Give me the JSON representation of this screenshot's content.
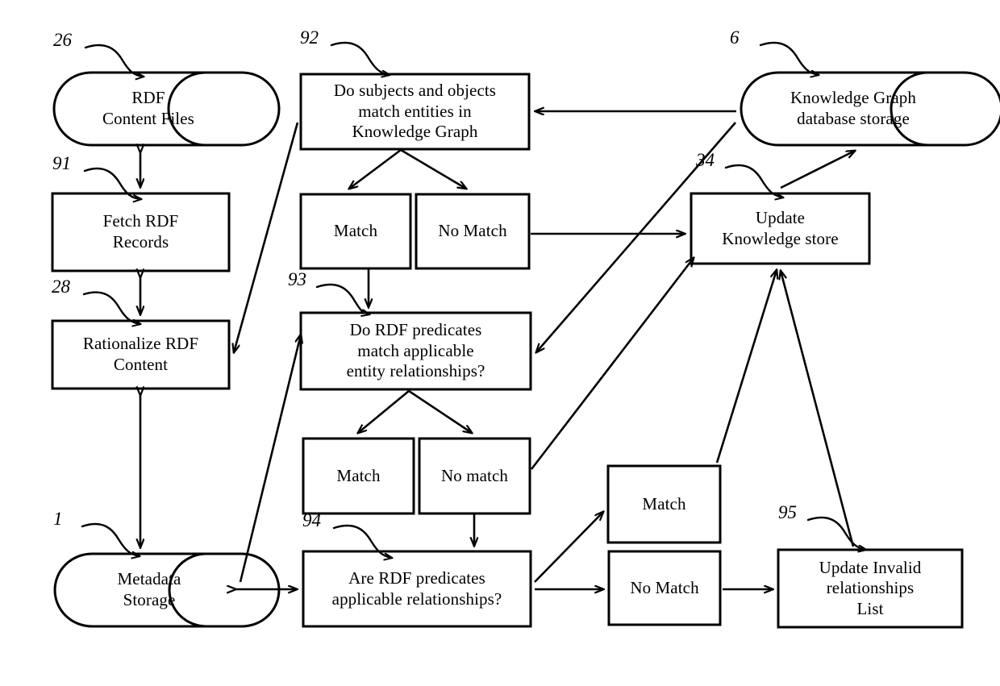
{
  "figure": {
    "kind": "patent-flowchart",
    "background_color": "#ffffff",
    "line_color": "#000000"
  },
  "nodes": {
    "rdf_content_files": {
      "label": "RDF\nContent Files",
      "shape": "cylinder",
      "ref": "26"
    },
    "fetch_rdf_records": {
      "label": "Fetch RDF\nRecords",
      "shape": "rect",
      "ref": "91"
    },
    "rationalize_rdf_content": {
      "label": "Rationalize RDF\nContent",
      "shape": "rect",
      "ref": "28"
    },
    "metadata_storage": {
      "label": "Metadata\nStorage",
      "shape": "cylinder",
      "ref": "1"
    },
    "subjects_objects_match": {
      "label": "Do subjects and objects\nmatch entities in\nKnowledge Graph",
      "shape": "rect",
      "ref": "92"
    },
    "match_92": {
      "label": "Match",
      "shape": "rect",
      "ref": ""
    },
    "no_match_92": {
      "label": "No Match",
      "shape": "rect",
      "ref": ""
    },
    "rdf_predicates_match": {
      "label": "Do RDF predicates\nmatch applicable\nentity relationships?",
      "shape": "rect",
      "ref": "93"
    },
    "match_93": {
      "label": "Match",
      "shape": "rect",
      "ref": ""
    },
    "no_match_93": {
      "label": "No match",
      "shape": "rect",
      "ref": ""
    },
    "rdf_predicates_applicable": {
      "label": "Are RDF predicates\napplicable relationships?",
      "shape": "rect",
      "ref": "94"
    },
    "match_94": {
      "label": "Match",
      "shape": "rect",
      "ref": ""
    },
    "no_match_94": {
      "label": "No Match",
      "shape": "rect",
      "ref": ""
    },
    "knowledge_graph_storage": {
      "label": "Knowledge Graph\ndatabase storage",
      "shape": "cylinder",
      "ref": "6"
    },
    "update_knowledge_store": {
      "label": "Update\nKnowledge store",
      "shape": "rect",
      "ref": "34"
    },
    "update_invalid_relationships": {
      "label": "Update Invalid\nrelationships\nList",
      "shape": "rect",
      "ref": "95"
    }
  },
  "reference_numerals": [
    {
      "id": "ref-26",
      "text": "26"
    },
    {
      "id": "ref-91",
      "text": "91"
    },
    {
      "id": "ref-28",
      "text": "28"
    },
    {
      "id": "ref-1",
      "text": "1"
    },
    {
      "id": "ref-92",
      "text": "92"
    },
    {
      "id": "ref-93",
      "text": "93"
    },
    {
      "id": "ref-94",
      "text": "94"
    },
    {
      "id": "ref-95",
      "text": "95"
    },
    {
      "id": "ref-6",
      "text": "6"
    },
    {
      "id": "ref-34",
      "text": "34"
    }
  ]
}
